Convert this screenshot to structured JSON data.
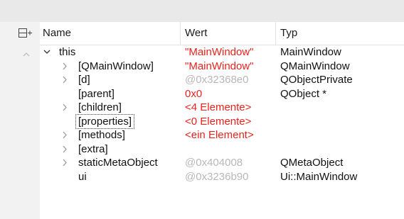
{
  "header": {
    "name": "Name",
    "value": "Wert",
    "type": "Typ"
  },
  "rows": [
    {
      "name": "this",
      "value": "\"MainWindow\"",
      "type": "MainWindow"
    },
    {
      "name": "[QMainWindow]",
      "value": "\"MainWindow\"",
      "type": "QMainWindow"
    },
    {
      "name": "[d]",
      "value": "@0x32368e0",
      "type": "QObjectPrivate"
    },
    {
      "name": "[parent]",
      "value": "0x0",
      "type": "QObject *"
    },
    {
      "name": "[children]",
      "value": "<4 Elemente>",
      "type": ""
    },
    {
      "name": "[properties]",
      "value": "<0 Elemente>",
      "type": ""
    },
    {
      "name": "[methods]",
      "value": "<ein Element>",
      "type": ""
    },
    {
      "name": "[extra]",
      "value": "",
      "type": ""
    },
    {
      "name": "staticMetaObject",
      "value": "@0x404008",
      "type": "QMetaObject"
    },
    {
      "name": "ui",
      "value": "@0x3236b90",
      "type": "Ui::MainWindow"
    }
  ],
  "colors": {
    "value_string": "#e8231e",
    "value_address": "#b7b7b7",
    "text": "#111111",
    "header_bg": "#e9e9e9",
    "gutter_bg": "#f2f2f2"
  },
  "icons": {
    "gutter_button": "expand-all-icon",
    "gutter_collapse": "chevron-up-icon",
    "expanded": "chevron-down-icon",
    "collapsed": "chevron-right-icon"
  }
}
